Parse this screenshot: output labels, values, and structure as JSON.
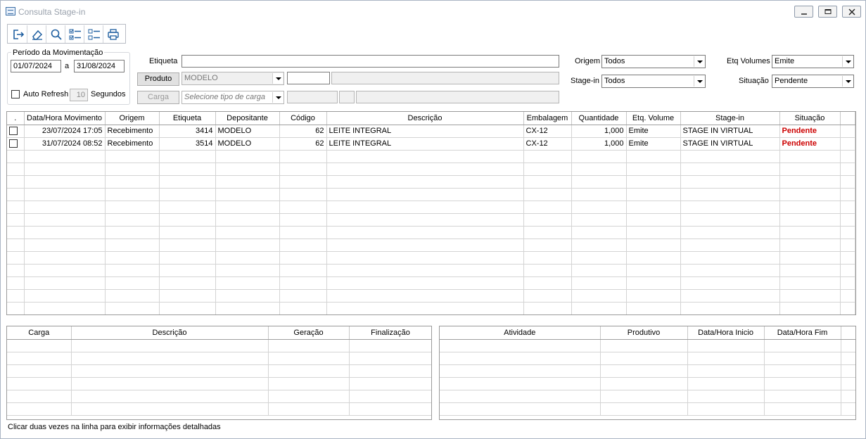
{
  "window": {
    "title": "Consulta Stage-in"
  },
  "toolbar": {
    "items": [
      "exit-icon",
      "eraser-icon",
      "search-icon",
      "check-list-icon",
      "uncheck-list-icon",
      "print-icon"
    ]
  },
  "periodo": {
    "label": "Período da Movimentação",
    "from": "01/07/2024",
    "sep": "a",
    "to": "31/08/2024",
    "auto_refresh_label": "Auto Refresh",
    "refresh_value": "10",
    "seconds_label": "Segundos"
  },
  "filters": {
    "etiqueta_label": "Etiqueta",
    "etiqueta_value": "",
    "produto_button": "Produto",
    "produto_value": "MODELO",
    "carga_button": "Carga",
    "carga_placeholder": "Selecione tipo de carga",
    "origem_label": "Origem",
    "origem_value": "Todos",
    "stagein_label": "Stage-in",
    "stagein_value": "Todos",
    "etqvol_label": "Etq Volumes",
    "etqvol_value": "Emite",
    "situacao_label": "Situação",
    "situacao_value": "Pendente"
  },
  "main_table": {
    "headers": [
      ".",
      "Data/Hora Movimento",
      "Origem",
      "Etiqueta",
      "Depositante",
      "Código",
      "Descrição",
      "Embalagem",
      "Quantidade",
      "Etq. Volume",
      "Stage-in",
      "Situação"
    ],
    "rows": [
      [
        "",
        "23/07/2024 17:05",
        "Recebimento",
        "3414",
        "MODELO",
        "62",
        "LEITE INTEGRAL",
        "CX-12",
        "1,000",
        "Emite",
        "STAGE IN VIRTUAL",
        "Pendente"
      ],
      [
        "",
        "31/07/2024 08:52",
        "Recebimento",
        "3514",
        "MODELO",
        "62",
        "LEITE INTEGRAL",
        "CX-12",
        "1,000",
        "Emite",
        "STAGE IN VIRTUAL",
        "Pendente"
      ]
    ]
  },
  "carga_table": {
    "headers": [
      "Carga",
      "Descrição",
      "Geração",
      "Finalização"
    ]
  },
  "atividade_table": {
    "headers": [
      "Atividade",
      "Produtivo",
      "Data/Hora Inicio",
      "Data/Hora Fim"
    ]
  },
  "status": {
    "text": "Clicar duas vezes na linha para exibir informações detalhadas"
  },
  "colors": {
    "pending": "#cc0000"
  }
}
